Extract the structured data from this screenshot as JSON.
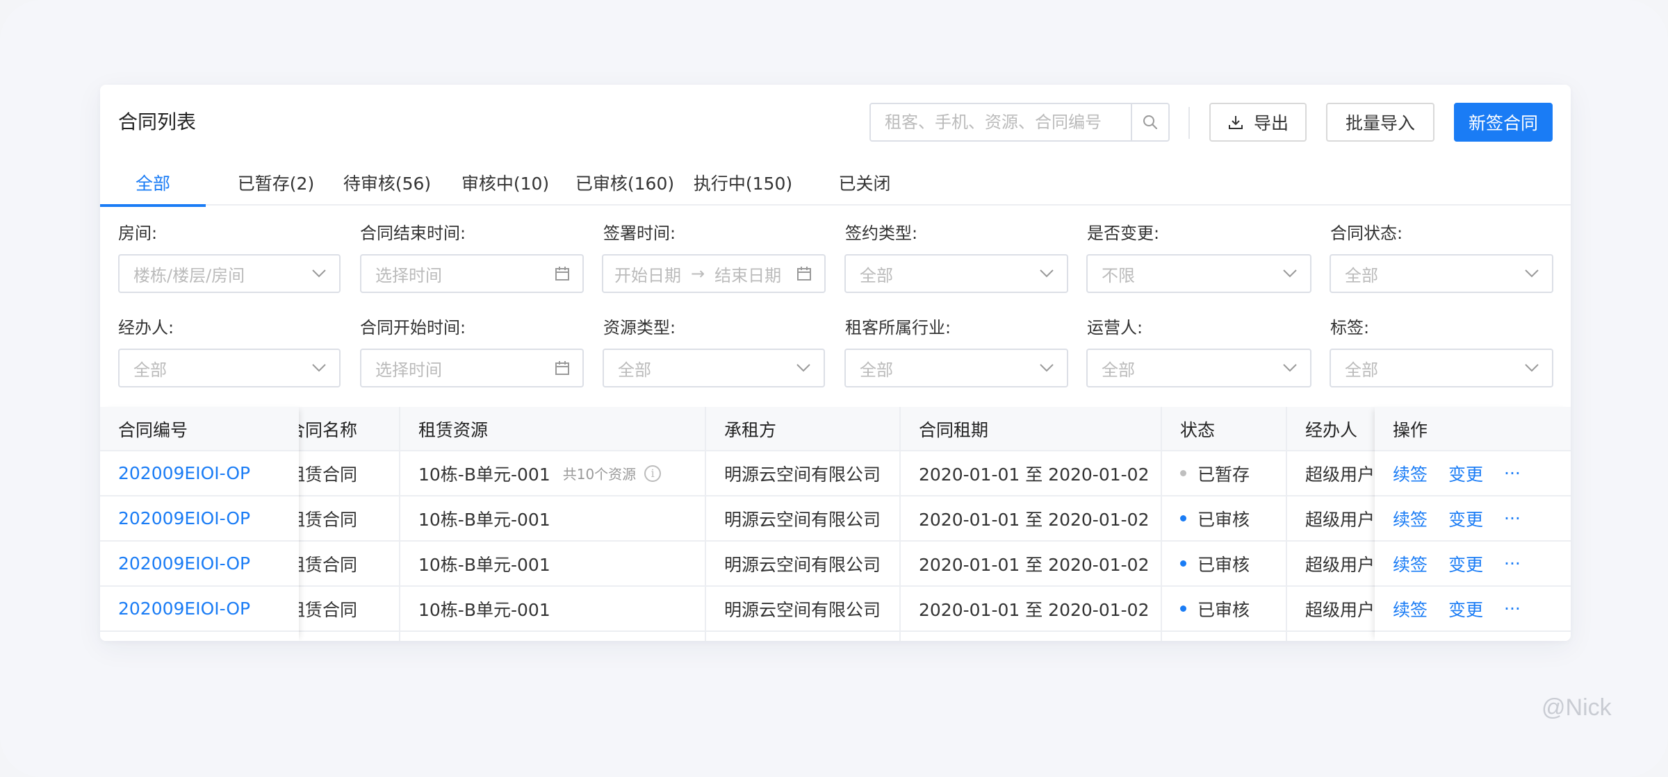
{
  "header": {
    "title": "合同列表",
    "search_placeholder": "租客、手机、资源、合同编号",
    "export_label": "导出",
    "import_label": "批量导入",
    "new_label": "新签合同"
  },
  "tabs": [
    {
      "label": "全部",
      "active": true
    },
    {
      "label": "已暂存(2)"
    },
    {
      "label": "待审核(56)"
    },
    {
      "label": "审核中(10)"
    },
    {
      "label": "已审核(160)"
    },
    {
      "label": "执行中(150)"
    },
    {
      "label": "已关闭"
    }
  ],
  "filters": {
    "room": {
      "label": "房间:",
      "placeholder": "楼栋/楼层/房间"
    },
    "end_time": {
      "label": "合同结束时间:",
      "placeholder": "选择时间"
    },
    "sign_time": {
      "label": "签署时间:",
      "start_placeholder": "开始日期",
      "end_placeholder": "结束日期",
      "arrow": "→"
    },
    "sign_type": {
      "label": "签约类型:",
      "value": "全部"
    },
    "changed": {
      "label": "是否变更:",
      "value": "不限"
    },
    "status": {
      "label": "合同状态:",
      "value": "全部"
    },
    "handler": {
      "label": "经办人:",
      "value": "全部"
    },
    "start_time": {
      "label": "合同开始时间:",
      "placeholder": "选择时间"
    },
    "resource_type": {
      "label": "资源类型:",
      "value": "全部"
    },
    "industry": {
      "label": "租客所属行业:",
      "value": "全部"
    },
    "operator": {
      "label": "运营人:",
      "value": "全部"
    },
    "tag": {
      "label": "标签:",
      "value": "全部"
    }
  },
  "table": {
    "columns": [
      "合同编号",
      "合同名称",
      "租赁资源",
      "承租方",
      "合同租期",
      "状态",
      "经办人",
      "操作"
    ],
    "rows": [
      {
        "id": "202009EIOI-OP",
        "name": "租赁合同",
        "resource": "10栋-B单元-001",
        "resource_extra": "共10个资源",
        "tenant": "明源云空间有限公司",
        "term": "2020-01-01 至 2020-01-02",
        "status": "已暂存",
        "status_color": "#bfbfbf",
        "handler": "超级用户",
        "action1": "续签",
        "action2": "变更",
        "more": "···"
      },
      {
        "id": "202009EIOI-OP",
        "name": "租赁合同",
        "resource": "10栋-B单元-001",
        "resource_extra": "",
        "tenant": "明源云空间有限公司",
        "term": "2020-01-01 至 2020-01-02",
        "status": "已审核",
        "status_color": "#1a7cf5",
        "handler": "超级用户",
        "action1": "续签",
        "action2": "变更",
        "more": "···"
      },
      {
        "id": "202009EIOI-OP",
        "name": "租赁合同",
        "resource": "10栋-B单元-001",
        "resource_extra": "",
        "tenant": "明源云空间有限公司",
        "term": "2020-01-01 至 2020-01-02",
        "status": "已审核",
        "status_color": "#1a7cf5",
        "handler": "超级用户",
        "action1": "续签",
        "action2": "变更",
        "more": "···"
      },
      {
        "id": "202009EIOI-OP",
        "name": "租赁合同",
        "resource": "10栋-B单元-001",
        "resource_extra": "",
        "tenant": "明源云空间有限公司",
        "term": "2020-01-01 至 2020-01-02",
        "status": "已审核",
        "status_color": "#1a7cf5",
        "handler": "超级用户",
        "action1": "续签",
        "action2": "变更",
        "more": "···"
      }
    ]
  },
  "watermark": "@Nick",
  "colors": {
    "primary": "#1a7cf5",
    "border": "#dcdfe6",
    "header_bg": "#f7f8fa"
  }
}
